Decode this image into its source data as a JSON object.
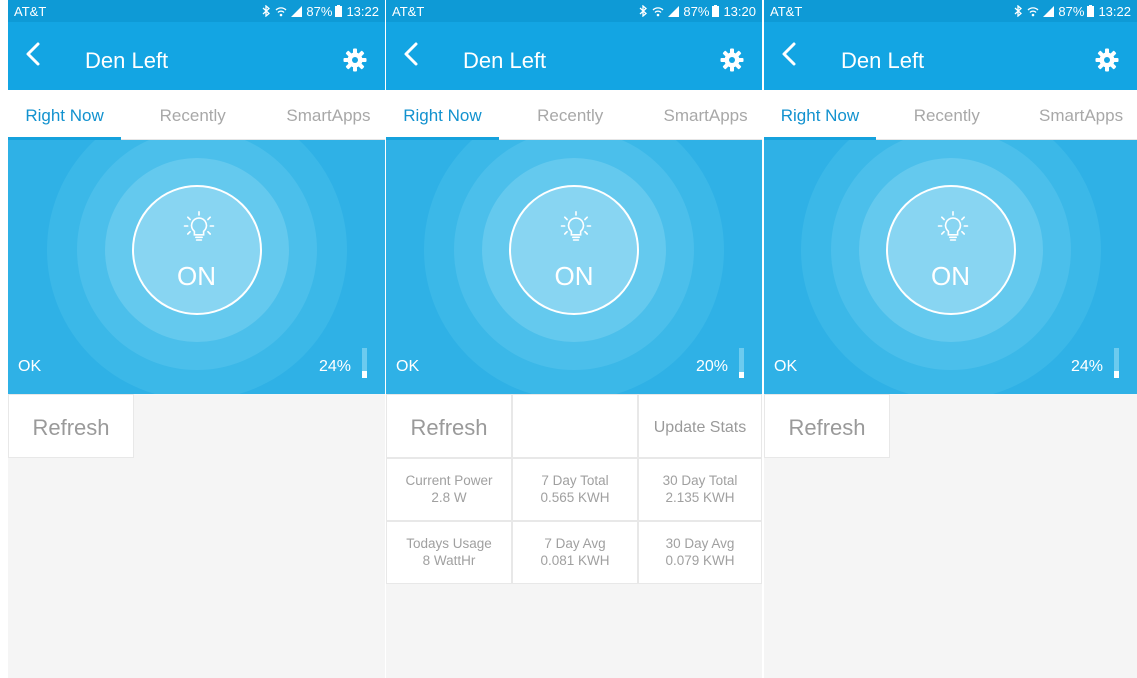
{
  "screens": [
    {
      "status": {
        "carrier": "AT&T",
        "battery": "87%",
        "time": "13:22"
      },
      "device_title": "Den Left",
      "tabs": [
        "Right Now",
        "Recently",
        "SmartApps"
      ],
      "state": "ON",
      "health": "OK",
      "level_label": "24%",
      "level_value": 0.24,
      "refresh_label": "Refresh"
    },
    {
      "status": {
        "carrier": "AT&T",
        "battery": "87%",
        "time": "13:20"
      },
      "device_title": "Den Left",
      "tabs": [
        "Right Now",
        "Recently",
        "SmartApps"
      ],
      "state": "ON",
      "health": "OK",
      "level_label": "20%",
      "level_value": 0.2,
      "refresh_label": "Refresh",
      "update_label": "Update Stats",
      "stats": [
        {
          "label": "Current Power",
          "value": "2.8 W"
        },
        {
          "label": "7 Day Total",
          "value": "0.565 KWH"
        },
        {
          "label": "30 Day Total",
          "value": "2.135 KWH"
        },
        {
          "label": "Todays Usage",
          "value": "8 WattHr"
        },
        {
          "label": "7 Day Avg",
          "value": "0.081 KWH"
        },
        {
          "label": "30 Day Avg",
          "value": "0.079 KWH"
        }
      ]
    },
    {
      "status": {
        "carrier": "AT&T",
        "battery": "87%",
        "time": "13:22"
      },
      "device_title": "Den Left",
      "tabs": [
        "Right Now",
        "Recently",
        "SmartApps"
      ],
      "state": "ON",
      "health": "OK",
      "level_label": "24%",
      "level_value": 0.24,
      "refresh_label": "Refresh"
    }
  ],
  "icons": {
    "back": "chevron-left-icon",
    "settings": "gear-icon",
    "bulb": "lightbulb-icon",
    "bluetooth": "bluetooth-icon",
    "wifi": "wifi-icon",
    "signal": "signal-icon",
    "battery": "battery-icon"
  },
  "colors": {
    "status_bar": "#0e9ad6",
    "app_bar": "#13a5e3",
    "hero": "#2fb1e6",
    "tab_active": "#1292cf",
    "tab_inactive": "#a8a8a8",
    "tile_text": "#9a9a9a"
  }
}
